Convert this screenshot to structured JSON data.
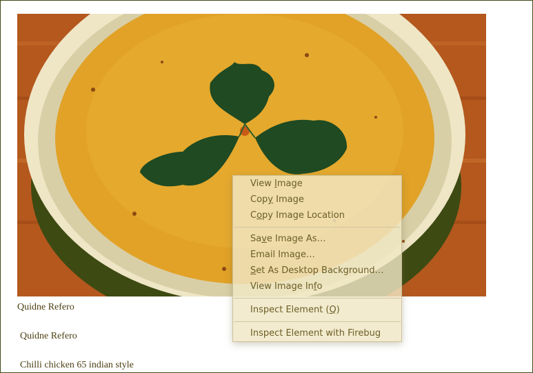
{
  "page": {
    "text_lines": [
      "Quidne Refero",
      "Quidne Refero",
      "Chilli chicken 65 indian style"
    ]
  },
  "image": {
    "subject": "bowl of yellow soup with parsley leaves"
  },
  "context_menu": {
    "items": [
      {
        "pre": "View ",
        "key": "I",
        "post": "mage"
      },
      {
        "pre": "Cop",
        "key": "y",
        "post": " Image"
      },
      {
        "pre": "C",
        "key": "o",
        "post": "py Image Location"
      },
      {
        "pre": "Sa",
        "key": "v",
        "post": "e Image As…"
      },
      {
        "pre": "Email Ima",
        "key": "g",
        "post": "e…"
      },
      {
        "pre": "",
        "key": "S",
        "post": "et As Desktop Background…"
      },
      {
        "pre": "View Image In",
        "key": "f",
        "post": "o"
      },
      {
        "pre": "Inspect Element (",
        "key": "Q",
        "post": ")"
      },
      {
        "pre": "Inspect Element with Firebug",
        "key": "",
        "post": ""
      }
    ]
  },
  "colors": {
    "frame_border": "#3d4a12",
    "page_text": "#4a3e10",
    "menu_bg": "#f0e6c4",
    "menu_text": "#6b5e26"
  }
}
